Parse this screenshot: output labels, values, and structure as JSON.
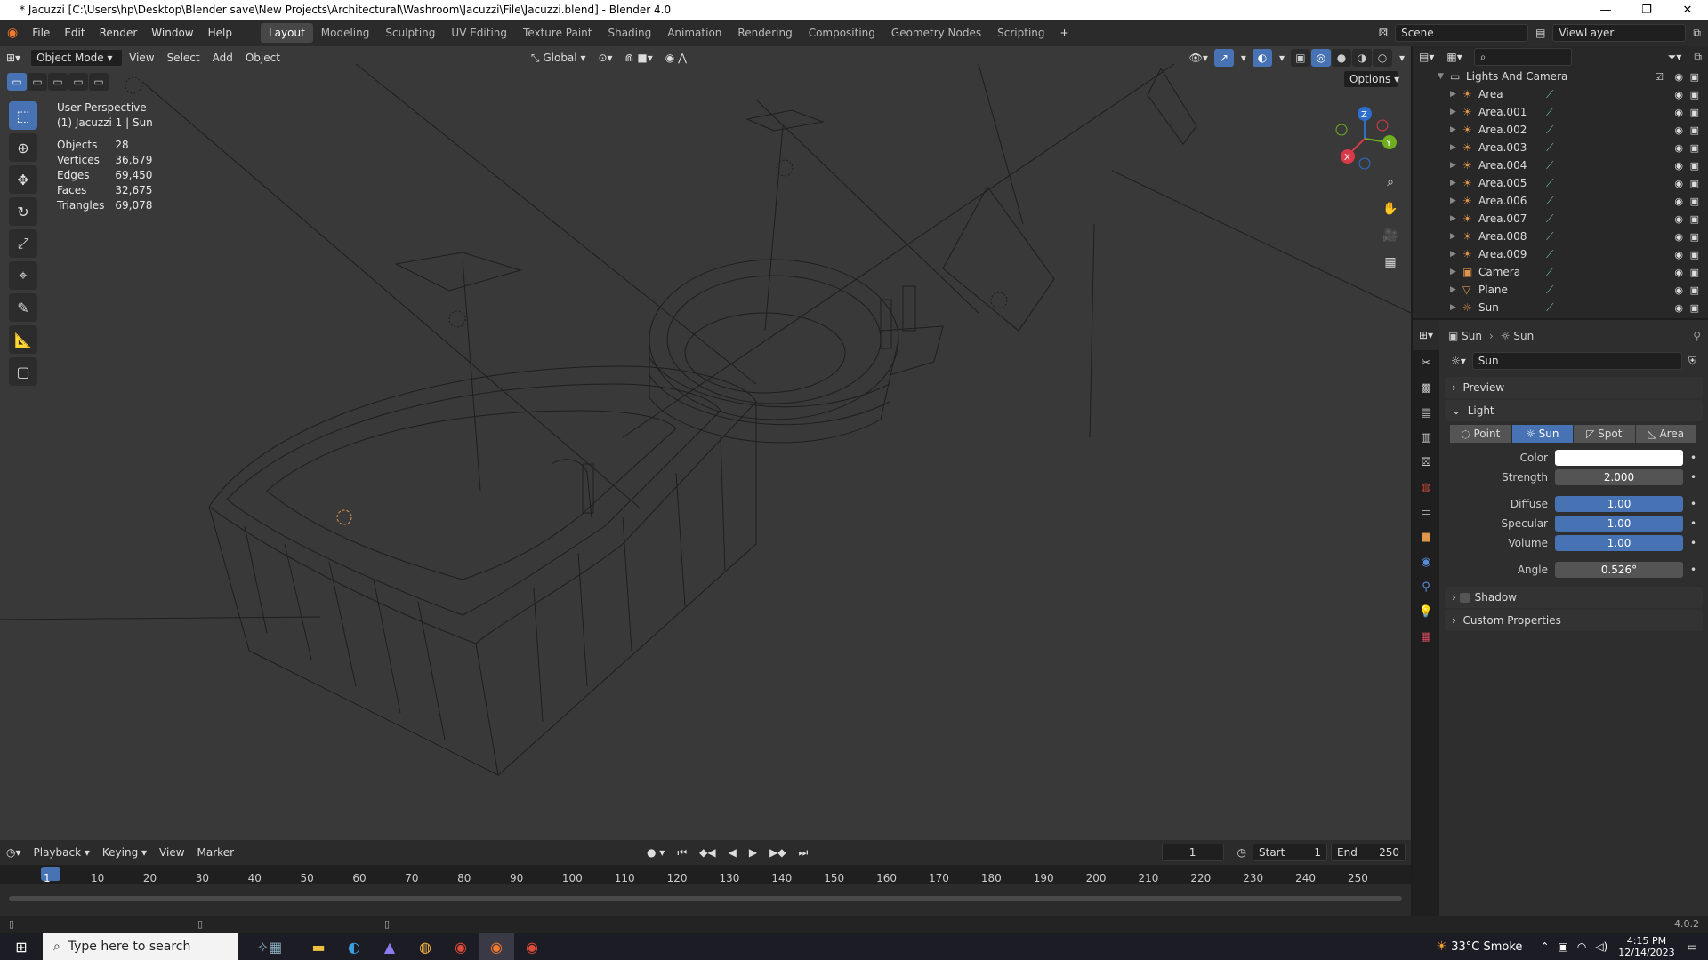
{
  "window": {
    "title": "* Jacuzzi [C:\\Users\\hp\\Desktop\\Blender save\\New Projects\\Architectural\\Washroom\\Jacuzzi\\File\\Jacuzzi.blend] - Blender 4.0",
    "minimize": "—",
    "maximize": "❐",
    "close": "✕"
  },
  "menu": [
    "File",
    "Edit",
    "Render",
    "Window",
    "Help"
  ],
  "workspaces": [
    "Layout",
    "Modeling",
    "Sculpting",
    "UV Editing",
    "Texture Paint",
    "Shading",
    "Animation",
    "Rendering",
    "Compositing",
    "Geometry Nodes",
    "Scripting"
  ],
  "active_workspace": "Layout",
  "scene": "Scene",
  "view_layer": "ViewLayer",
  "viewport": {
    "mode": "Object Mode",
    "menus": [
      "View",
      "Select",
      "Add",
      "Object"
    ],
    "transform_orientation": "Global",
    "options_label": "Options",
    "perspective_label": "User Perspective",
    "active_label": "(1) Jacuzzi 1 | Sun",
    "stats": [
      {
        "label": "Objects",
        "value": "28"
      },
      {
        "label": "Vertices",
        "value": "36,679"
      },
      {
        "label": "Edges",
        "value": "69,450"
      },
      {
        "label": "Faces",
        "value": "32,675"
      },
      {
        "label": "Triangles",
        "value": "69,078"
      }
    ],
    "axes": {
      "x": "X",
      "y": "Y",
      "z": "Z"
    }
  },
  "timeline": {
    "menus": [
      "Playback",
      "Keying",
      "View",
      "Marker"
    ],
    "current_frame": "1",
    "start_label": "Start",
    "start": "1",
    "end_label": "End",
    "end": "250",
    "frames": [
      "1",
      "10",
      "20",
      "30",
      "40",
      "50",
      "60",
      "70",
      "80",
      "90",
      "100",
      "110",
      "120",
      "130",
      "140",
      "150",
      "160",
      "170",
      "180",
      "190",
      "200",
      "210",
      "220",
      "230",
      "240",
      "250"
    ]
  },
  "outliner": {
    "collection": "Lights And Camera",
    "items": [
      {
        "name": "Area",
        "icon": "light-icon"
      },
      {
        "name": "Area.001",
        "icon": "light-icon"
      },
      {
        "name": "Area.002",
        "icon": "light-icon"
      },
      {
        "name": "Area.003",
        "icon": "light-icon"
      },
      {
        "name": "Area.004",
        "icon": "light-icon"
      },
      {
        "name": "Area.005",
        "icon": "light-icon"
      },
      {
        "name": "Area.006",
        "icon": "light-icon"
      },
      {
        "name": "Area.007",
        "icon": "light-icon"
      },
      {
        "name": "Area.008",
        "icon": "light-icon"
      },
      {
        "name": "Area.009",
        "icon": "light-icon"
      },
      {
        "name": "Camera",
        "icon": "camera-icon"
      },
      {
        "name": "Plane",
        "icon": "mesh-icon"
      },
      {
        "name": "Sun",
        "icon": "sun-icon"
      }
    ]
  },
  "properties": {
    "breadcrumb_object": "Sun",
    "breadcrumb_data": "Sun",
    "datablock_name": "Sun",
    "panels": {
      "preview": "Preview",
      "light": "Light",
      "shadow": "Shadow",
      "custom": "Custom Properties"
    },
    "light_types": [
      "Point",
      "Sun",
      "Spot",
      "Area"
    ],
    "active_light_type": "Sun",
    "fields": {
      "color_label": "Color",
      "strength_label": "Strength",
      "strength": "2.000",
      "diffuse_label": "Diffuse",
      "diffuse": "1.00",
      "specular_label": "Specular",
      "specular": "1.00",
      "volume_label": "Volume",
      "volume": "1.00",
      "angle_label": "Angle",
      "angle": "0.526°"
    },
    "color_value": "#ffffff"
  },
  "statusbar": {
    "version": "4.0.2"
  },
  "taskbar": {
    "search_placeholder": "Type here to search",
    "weather": "33°C  Smoke",
    "time": "4:15 PM",
    "date": "12/14/2023"
  },
  "colors": {
    "accent": "#4772b3",
    "light_orange": "#e0954a",
    "viewport_bg": "#393939"
  }
}
